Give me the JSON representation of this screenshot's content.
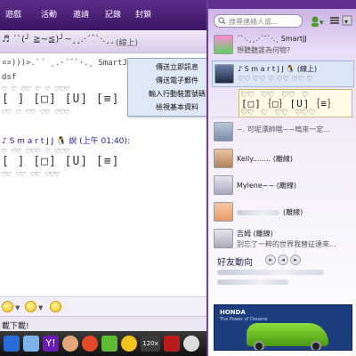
{
  "chat": {
    "menu": [
      "遊戲",
      "活動",
      "邀請",
      "記錄",
      "封鎖"
    ],
    "header_title": "♬ ´`(╯ ≧~≦)╯~¸¸.·´¯`·.¸¸",
    "header_status": "(線上)",
    "messages": [
      {
        "line": "¤¤)))>.`´ ¸.·´¯`·.¸ SmartJJ .·´¯`·.¸"
      },
      {
        "line": "dsf"
      },
      {
        "art1": "♡ ♡ ♡♡ ♡ ♡ ♡♡♡"
      },
      {
        "art2": "[ ] [□] [U] [≡]"
      },
      {
        "art3": "♡♡ ♡ ♡♡ ♡♡ ♡♡♡"
      },
      {
        "sender": "♪ S m a r t J J 🐧 說 (上午 01:40):"
      },
      {
        "art1": "♡ ♡♡ ♡♡♡ ♡ ♡♡♡"
      },
      {
        "art2": "[ ] [□] [U] [≡]"
      },
      {
        "art3": "♡♡ ♡♡ ♡♡ ♡♡♡"
      }
    ],
    "context_menu": [
      "傳送立即訊息",
      "傳送電子郵件",
      "輸入行動裝置號碼",
      "檢視基本資料"
    ],
    "status_text": "載下載!",
    "taskbar_app_label": "120x"
  },
  "panel": {
    "search_placeholder": "搜尋連絡人或...",
    "contacts": [
      {
        "name": "´`·.¸¸.·´¯`·.¸ SmartJJ",
        "status": "想聽聽誰為何物?"
      },
      {
        "name": "♪ S m a r t J J 🐧 (線上)",
        "status": "♡♡ ♡♡ ♡ ♡♡ ♡♡ ♡"
      },
      {
        "name": "",
        "status": "~. 可呢漂帥哦~~嗚來一定..."
      },
      {
        "name": "Kelly........ (離線)",
        "status": ""
      },
      {
        "name": "Mylene~~ (離線)",
        "status": ""
      },
      {
        "name": "(離線)",
        "status": ""
      },
      {
        "name": "吉姆 (離線)",
        "status": "別忘了一粹的世界我替征達來..."
      }
    ],
    "popup_art": "♡♡ ♡♡ ♡♡ ♡\n[□]｛□｝[U]｛≡｝\n♡♡ ♡ ♡♡ ♡♡♡",
    "feed_title": "好友動向",
    "ad_brand": "HONDA",
    "ad_tag": "The Power of Dreams"
  }
}
